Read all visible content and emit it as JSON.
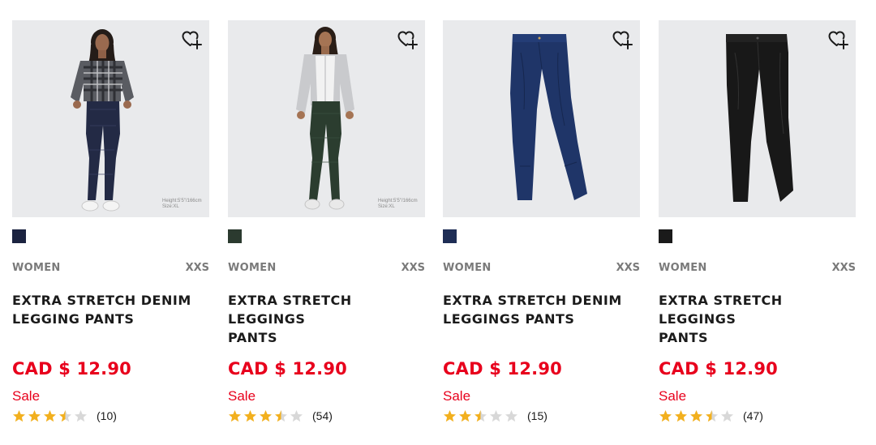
{
  "products": [
    {
      "gender": "WOMEN",
      "size": "XXS",
      "name_line1": "EXTRA STRETCH DENIM",
      "name_line2": "LEGGING PANTS",
      "price": "CAD $ 12.90",
      "sale": "Sale",
      "rating": 3.5,
      "review_count": "(10)",
      "swatch_color": "#1b2340",
      "image_caption_1": "Height:5'5\"/166cm",
      "image_caption_2": "Size:XL",
      "image": "model-in-plaid-shirt-and-navy-leggings"
    },
    {
      "gender": "WOMEN",
      "size": "XXS",
      "name_line1": "EXTRA STRETCH LEGGINGS",
      "name_line2": "PANTS",
      "price": "CAD $ 12.90",
      "sale": "Sale",
      "rating": 3.5,
      "review_count": "(54)",
      "swatch_color": "#2b3a2f",
      "image_caption_1": "Height:5'5\"/166cm",
      "image_caption_2": "Size:XL",
      "image": "model-in-grey-hoodie-and-green-leggings"
    },
    {
      "gender": "WOMEN",
      "size": "XXS",
      "name_line1": "EXTRA STRETCH DENIM",
      "name_line2": "LEGGINGS PANTS",
      "price": "CAD $ 12.90",
      "sale": "Sale",
      "rating": 2.5,
      "review_count": "(15)",
      "swatch_color": "#1e2d55",
      "image_caption_1": "",
      "image_caption_2": "",
      "image": "blue-denim-leggings-flat"
    },
    {
      "gender": "WOMEN",
      "size": "XXS",
      "name_line1": "EXTRA STRETCH LEGGINGS",
      "name_line2": "PANTS",
      "price": "CAD $ 12.90",
      "sale": "Sale",
      "rating": 3.5,
      "review_count": "(47)",
      "swatch_color": "#1a1a1a",
      "image_caption_1": "",
      "image_caption_2": "",
      "image": "black-leggings-flat"
    }
  ],
  "colors": {
    "price_red": "#e8001c",
    "star_gold": "#f2b01e",
    "star_empty": "#d8d8d8"
  }
}
